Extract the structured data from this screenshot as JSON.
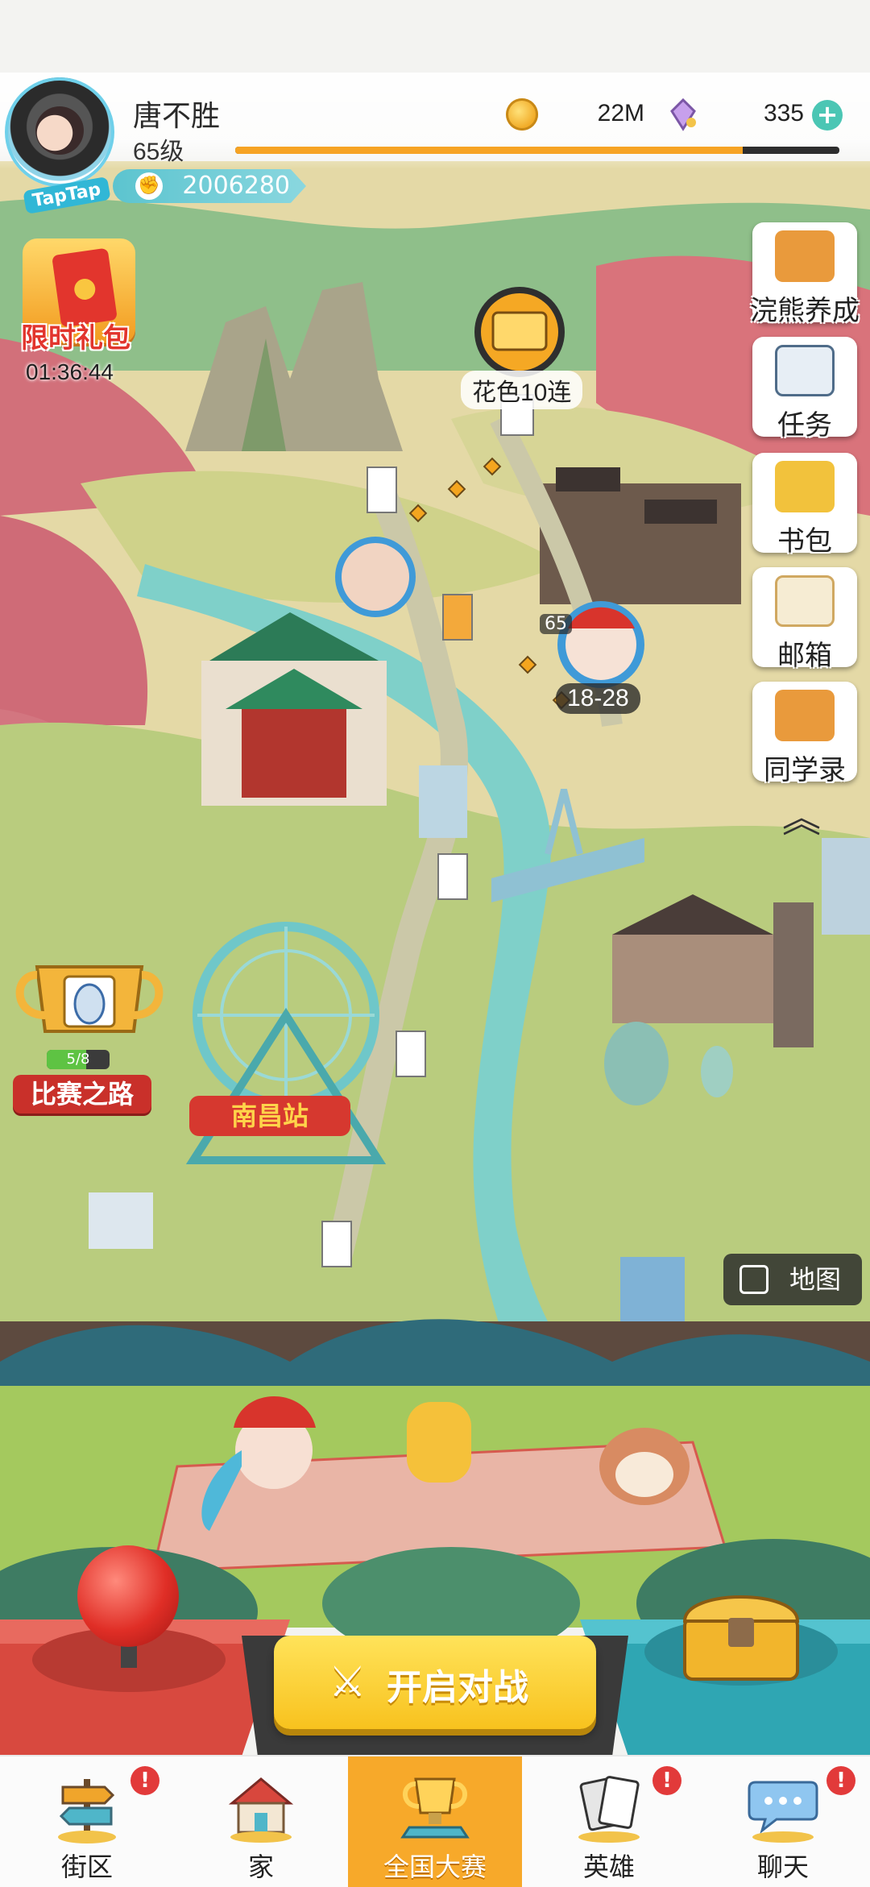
{
  "player": {
    "name": "唐不胜",
    "level": "65级",
    "xp_fraction": 0.84,
    "power": "2006280",
    "platform_badge": "TapTap"
  },
  "currency": {
    "coins": "22M",
    "gems": "335",
    "coin_icon": "coin-icon",
    "gem_icon": "gem-icon"
  },
  "gift": {
    "label": "限时礼包",
    "timer": "01:36:44"
  },
  "side_menu": [
    {
      "id": "raccoon-train",
      "label": "浣熊养成",
      "icon": "raccoon-icon"
    },
    {
      "id": "tasks",
      "label": "任务",
      "icon": "clipboard-icon"
    },
    {
      "id": "bag",
      "label": "书包",
      "icon": "backpack-icon"
    },
    {
      "id": "mail",
      "label": "邮箱",
      "icon": "envelope-icon"
    },
    {
      "id": "classmates",
      "label": "同学录",
      "icon": "raccoon-book-icon"
    }
  ],
  "map": {
    "reward_node_label": "花色10连",
    "player_node_level": "65",
    "player_node_range": "18-28",
    "trophy_progress": "5/8",
    "trophy_fraction": 0.625,
    "race_road_label": "比赛之路",
    "map_button_label": "地图",
    "city_sign": "南昌站"
  },
  "battle": {
    "label": "开启对战"
  },
  "nav": [
    {
      "id": "street",
      "label": "街区",
      "icon": "signpost-icon",
      "badge": "!"
    },
    {
      "id": "home",
      "label": "家",
      "icon": "house-icon",
      "badge": ""
    },
    {
      "id": "contest",
      "label": "全国大赛",
      "icon": "trophy-icon",
      "badge": "",
      "active": true
    },
    {
      "id": "heroes",
      "label": "英雄",
      "icon": "cards-icon",
      "badge": "!"
    },
    {
      "id": "chat",
      "label": "聊天",
      "icon": "chat-bubble-icon",
      "badge": "!"
    }
  ],
  "colors": {
    "accent_orange": "#f7a92a",
    "battle_yellow": "#f8c21e",
    "badge_red": "#e23a3a",
    "river": "#7fd0c9"
  }
}
